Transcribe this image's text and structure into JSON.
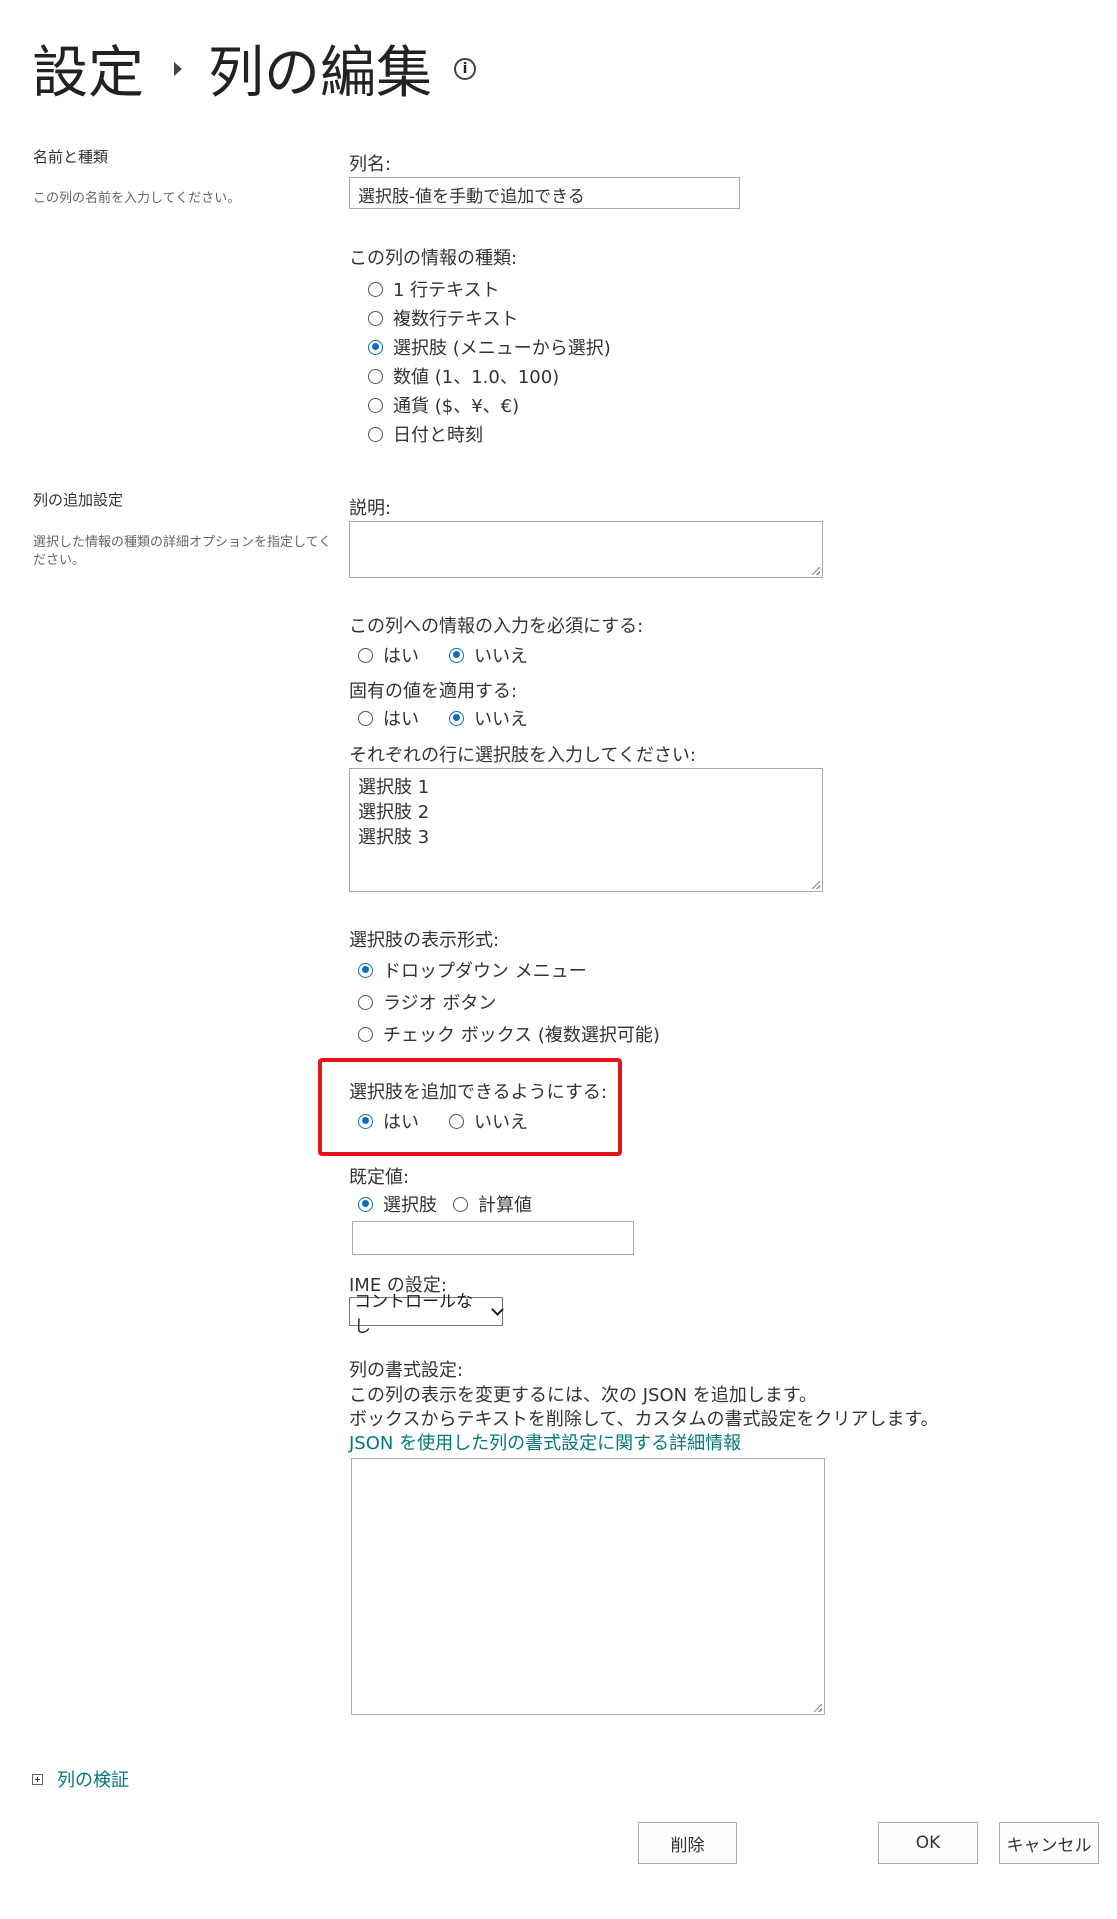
{
  "header": {
    "breadcrumb_root": "設定",
    "title": "列の編集"
  },
  "name_section": {
    "title": "名前と種類",
    "description": "この列の名前を入力してください。"
  },
  "column_name": {
    "label": "列名:",
    "value": "選択肢-値を手動で追加できる"
  },
  "info_type": {
    "label": "この列の情報の種類:",
    "options": [
      {
        "label": "1 行テキスト",
        "selected": false
      },
      {
        "label": "複数行テキスト",
        "selected": false
      },
      {
        "label": "選択肢 (メニューから選択)",
        "selected": true
      },
      {
        "label": "数値 (1、1.0、100)",
        "selected": false
      },
      {
        "label": "通貨 ($、¥、€)",
        "selected": false
      },
      {
        "label": "日付と時刻",
        "selected": false
      }
    ]
  },
  "additional_section": {
    "title": "列の追加設定",
    "description": "選択した情報の種類の詳細オプションを指定してください。"
  },
  "description_field": {
    "label": "説明:",
    "value": ""
  },
  "required": {
    "label": "この列への情報の入力を必須にする:",
    "yes": "はい",
    "no": "いいえ",
    "selected": "no"
  },
  "unique": {
    "label": "固有の値を適用する:",
    "yes": "はい",
    "no": "いいえ",
    "selected": "no"
  },
  "choices": {
    "label": "それぞれの行に選択肢を入力してください:",
    "lines": [
      "選択肢 1",
      "選択肢 2",
      "選択肢 3"
    ]
  },
  "display_format": {
    "label": "選択肢の表示形式:",
    "options": [
      {
        "label": "ドロップダウン メニュー",
        "selected": true
      },
      {
        "label": "ラジオ ボタン",
        "selected": false
      },
      {
        "label": "チェック ボックス (複数選択可能)",
        "selected": false
      }
    ]
  },
  "fill_in": {
    "label": "選択肢を追加できるようにする:",
    "yes": "はい",
    "no": "いいえ",
    "selected": "yes"
  },
  "default_value": {
    "label": "既定値:",
    "choice": "選択肢",
    "calculated": "計算値",
    "selected": "choice",
    "value": ""
  },
  "ime": {
    "label": "IME の設定:",
    "selected": "コントロールなし"
  },
  "formatting": {
    "label": "列の書式設定:",
    "line1": "この列の表示を変更するには、次の JSON を追加します。",
    "line2": "ボックスからテキストを削除して、カスタムの書式設定をクリアします。",
    "link": "JSON を使用した列の書式設定に関する詳細情報",
    "value": ""
  },
  "validation": {
    "label": "列の検証"
  },
  "buttons": {
    "delete": "削除",
    "ok": "OK",
    "cancel": "キャンセル"
  },
  "colors": {
    "accent": "#0f6cbd",
    "link": "#03787c",
    "highlight": "#e6141a"
  }
}
